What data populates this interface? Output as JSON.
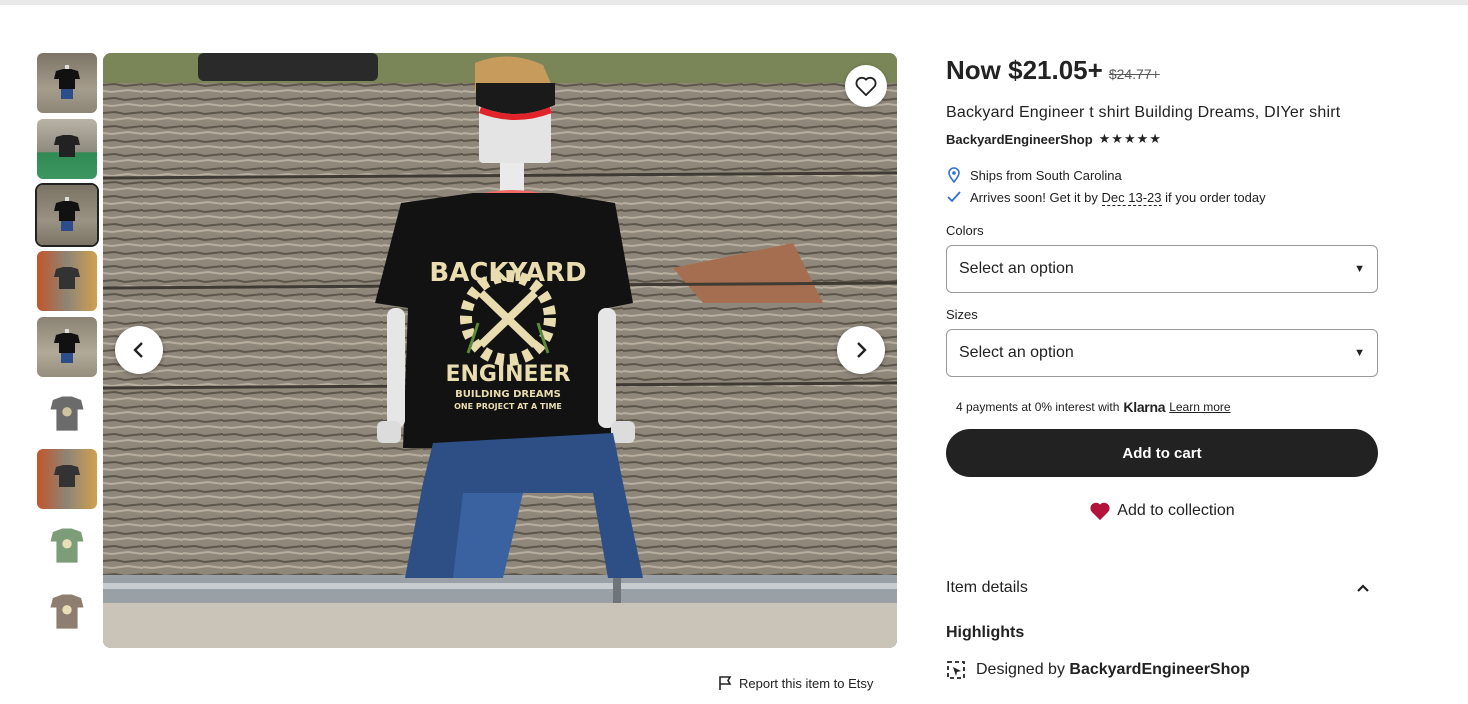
{
  "price": {
    "now": "Now $21.05+",
    "old": "$24.77+"
  },
  "listing": {
    "title": "Backyard Engineer t shirt Building Dreams, DIYer shirt"
  },
  "shop": {
    "name": "BackyardEngineerShop",
    "stars": "★★★★★"
  },
  "shipping": {
    "ships_from": "Ships from South Carolina",
    "arrives_prefix": "Arrives soon! Get it by",
    "arrives_date": "Dec 13-23",
    "arrives_suffix": "if you order today"
  },
  "options": {
    "colors_label": "Colors",
    "colors_value": "Select an option",
    "sizes_label": "Sizes",
    "sizes_value": "Select an option"
  },
  "klarna": {
    "text": "4 payments at 0% interest with",
    "logo": "Klarna",
    "link": "Learn more"
  },
  "actions": {
    "add_to_cart": "Add to cart",
    "add_to_collection": "Add to collection"
  },
  "details": {
    "heading": "Item details",
    "highlights": "Highlights",
    "designed_by": "Designed by",
    "designer": "BackyardEngineerShop"
  },
  "report": {
    "label": "Report this item to Etsy"
  },
  "shirt_print": {
    "line1": "BACKYARD",
    "line2": "ENGINEER",
    "line3": "BUILDING DREAMS",
    "line4": "ONE PROJECT AT A TIME"
  },
  "colors": {
    "accent_heart": "#b3123a",
    "button_dark": "#222222"
  }
}
